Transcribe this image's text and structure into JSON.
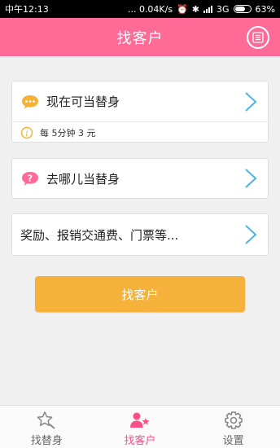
{
  "status_bar": {
    "time": "中午12:13",
    "net_speed": "... 0.04K/s",
    "network": "3G",
    "battery": "63%"
  },
  "header": {
    "title": "找客户",
    "menu_icon": "list-icon"
  },
  "cards": {
    "now": {
      "label": "现在可当替身",
      "icon": "chat-bubble-icon",
      "icon_color": "#f6b13a",
      "price_note": "每 5分钟 3 元",
      "info_icon": "info-icon"
    },
    "where": {
      "label": "去哪儿当替身",
      "icon": "question-bubble-icon",
      "icon_color": "#ff6a97"
    },
    "rewards": {
      "label": "奖励、报销交通费、门票等..."
    }
  },
  "cta": {
    "label": "找客户"
  },
  "tabbar": {
    "tabs": [
      {
        "label": "找替身",
        "icon": "find-substitute-icon",
        "active": false
      },
      {
        "label": "找客户",
        "icon": "find-client-icon",
        "active": true
      },
      {
        "label": "设置",
        "icon": "settings-gear-icon",
        "active": false
      }
    ]
  },
  "colors": {
    "brand_pink": "#ff6a97",
    "accent_orange": "#f6b13a",
    "chevron_blue": "#4fb3e8"
  }
}
